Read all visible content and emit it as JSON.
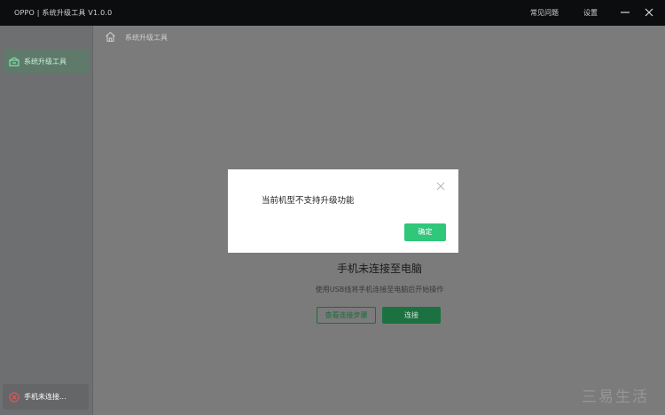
{
  "window": {
    "title": "OPPO | 系统升级工具  V1.0.0",
    "menu_faq": "常见问题",
    "menu_settings": "设置"
  },
  "sidebar": {
    "items": [
      {
        "label": "系统升级工具",
        "icon": "upgrade-box-icon",
        "active": true
      }
    ],
    "status": {
      "label": "手机未连接...",
      "icon": "error-circle-icon",
      "color": "#e05555"
    }
  },
  "main": {
    "breadcrumb": "系统升级工具",
    "empty_title": "手机未连接至电脑",
    "empty_hint": "使用USB线将手机连接至电脑后开始操作",
    "steps_button": "查看连接步骤",
    "connect_button": "连接"
  },
  "dialog": {
    "message": "当前机型不支持升级功能",
    "ok_button": "确定"
  },
  "watermark": "三易生活",
  "colors": {
    "accent": "#2fc77a",
    "titlebar": "#0c0d0f",
    "overlay": "#7b7b7b"
  }
}
